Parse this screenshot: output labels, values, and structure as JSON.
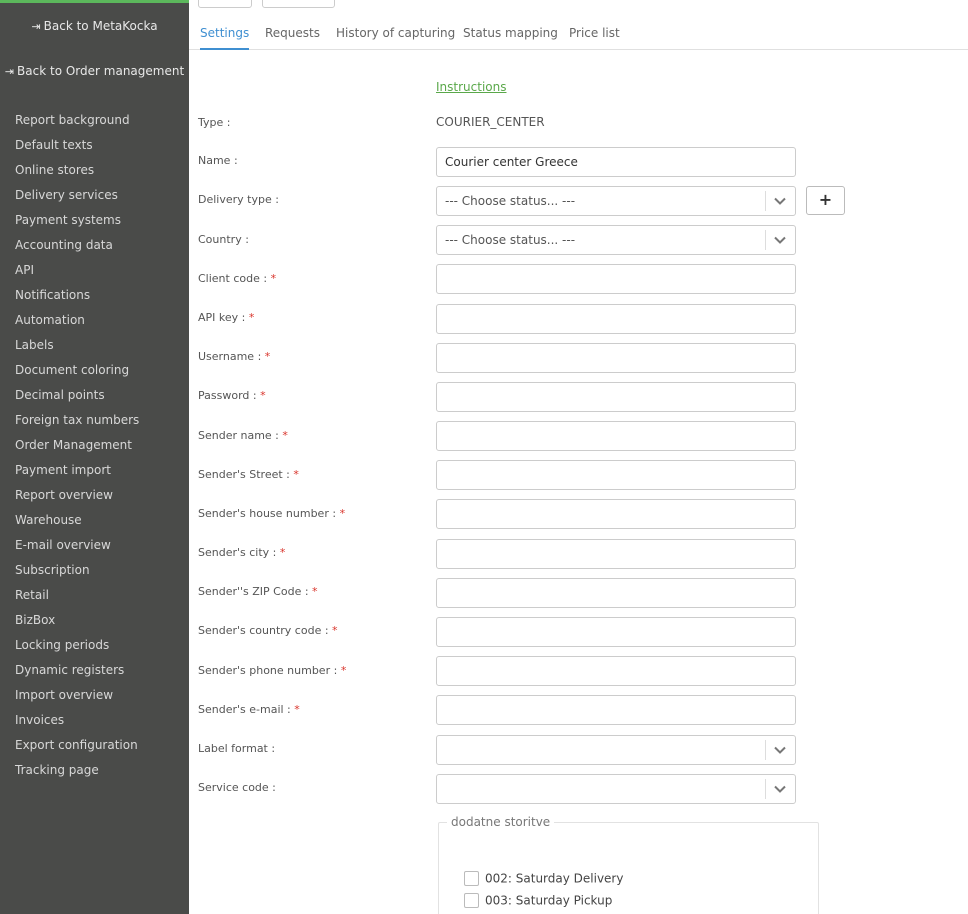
{
  "sidebar": {
    "back_metakocka": "Back to MetaKocka",
    "back_order_management": "Back to Order management",
    "items": [
      "Report background",
      "Default texts",
      "Online stores",
      "Delivery services",
      "Payment systems",
      "Accounting data",
      "API",
      "Notifications",
      "Automation",
      "Labels",
      "Document coloring",
      "Decimal points",
      "Foreign tax numbers",
      "Order Management",
      "Payment import",
      "Report overview",
      "Warehouse",
      "E-mail overview",
      "Subscription",
      "Retail",
      "BizBox",
      "Locking periods",
      "Dynamic registers",
      "Import overview",
      "Invoices",
      "Export configuration",
      "Tracking page"
    ]
  },
  "tabs": [
    "Settings",
    "Requests",
    "History of capturing",
    "Status mapping",
    "Price list"
  ],
  "active_tab": "Settings",
  "form": {
    "instructions_link": "Instructions",
    "type_label": "Type :",
    "type_value": "COURIER_CENTER",
    "name_label": "Name :",
    "name_value": "Courier center Greece",
    "delivery_type_label": "Delivery type :",
    "delivery_type_value": "--- Choose status... ---",
    "add_button": "+",
    "country_label": "Country :",
    "country_value": "--- Choose status... ---",
    "client_code_label": "Client code :",
    "api_key_label": "API key :",
    "username_label": "Username :",
    "password_label": "Password :",
    "sender_name_label": "Sender name :",
    "sender_street_label": "Sender's Street :",
    "sender_house_number_label": "Sender's house number :",
    "sender_city_label": "Sender's city :",
    "sender_zip_label": "Sender''s ZIP Code :",
    "sender_country_code_label": "Sender's country code :",
    "sender_phone_label": "Sender's phone number :",
    "sender_email_label": "Sender's e-mail :",
    "label_format_label": "Label format :",
    "service_code_label": "Service code :",
    "required_mark": "*"
  },
  "additional_services": {
    "legend": "dodatne storitve",
    "options": [
      "002: Saturday Delivery",
      "003: Saturday Pickup"
    ]
  }
}
